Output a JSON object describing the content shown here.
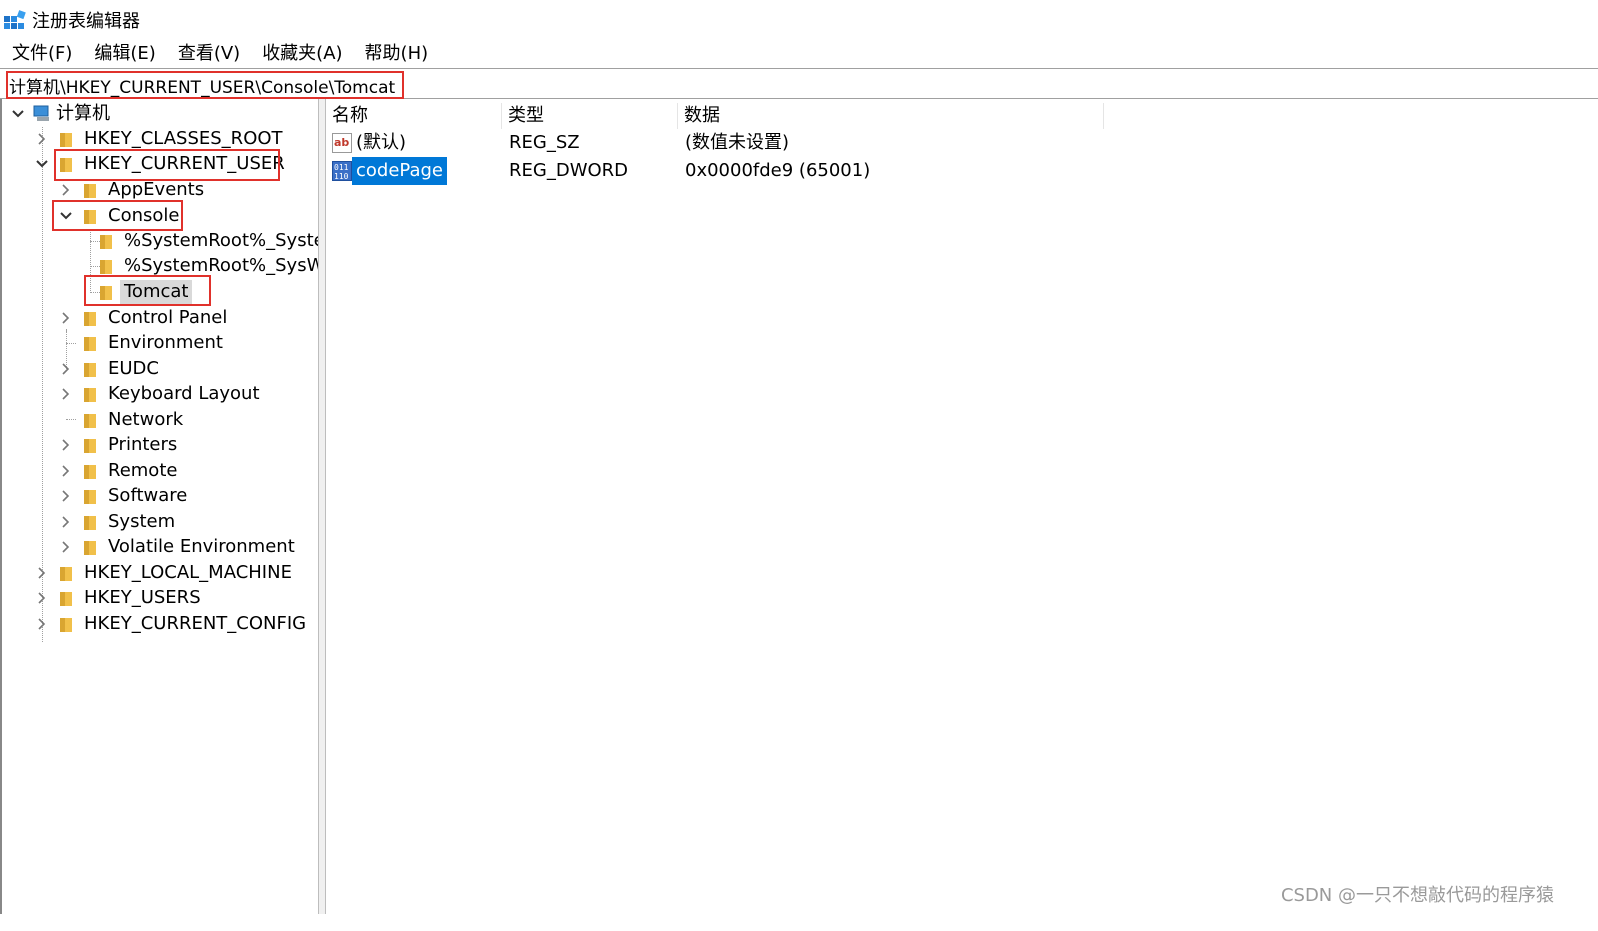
{
  "window": {
    "title": "注册表编辑器",
    "app_icon": "regedit-icon"
  },
  "menu": [
    {
      "label": "文件(F)"
    },
    {
      "label": "编辑(E)"
    },
    {
      "label": "查看(V)"
    },
    {
      "label": "收藏夹(A)"
    },
    {
      "label": "帮助(H)"
    }
  ],
  "address": {
    "value": "计算机\\HKEY_CURRENT_USER\\Console\\Tomcat"
  },
  "tree": {
    "root": "计算机",
    "hkcr": "HKEY_CLASSES_ROOT",
    "hkcu": "HKEY_CURRENT_USER",
    "appevents": "AppEvents",
    "console": "Console",
    "sys1": "%SystemRoot%_System",
    "sys2": "%SystemRoot%_SysWOW",
    "tomcat": "Tomcat",
    "control_panel": "Control Panel",
    "environment": "Environment",
    "eudc": "EUDC",
    "keyboard_layout": "Keyboard Layout",
    "network": "Network",
    "printers": "Printers",
    "remote": "Remote",
    "software": "Software",
    "system": "System",
    "volatile_environment": "Volatile Environment",
    "hklm": "HKEY_LOCAL_MACHINE",
    "hku": "HKEY_USERS",
    "hkcc": "HKEY_CURRENT_CONFIG"
  },
  "list": {
    "columns": {
      "name": "名称",
      "type": "类型",
      "data": "数据"
    },
    "rows": [
      {
        "name": "(默认)",
        "type": "REG_SZ",
        "data": "(数值未设置)",
        "icon": "string-value-icon"
      },
      {
        "name": "codePage",
        "type": "REG_DWORD",
        "data": "0x0000fde9 (65001)",
        "icon": "binary-value-icon"
      }
    ]
  },
  "watermark": "CSDN @一只不想敲代码的程序猿",
  "colors": {
    "highlight": "#e0312b",
    "selection": "#0078d7",
    "folder": "#f1c04a"
  }
}
